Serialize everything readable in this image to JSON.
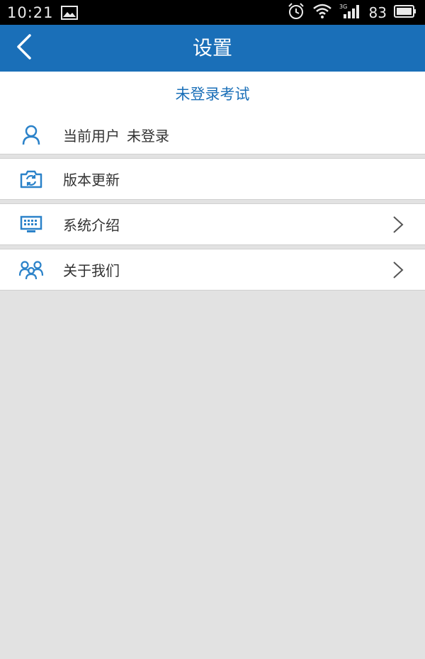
{
  "status_bar": {
    "time": "10:21",
    "battery": "83",
    "icons": [
      "image-icon",
      "alarm-icon",
      "wifi-icon",
      "3g-signal-icon",
      "battery-icon"
    ]
  },
  "header": {
    "title": "设置",
    "back_icon": "back-arrow-icon",
    "background": "#1a6fb8"
  },
  "login_banner": {
    "text": "未登录考试"
  },
  "user": {
    "label": "当前用户",
    "value": "未登录",
    "icon": "user-icon"
  },
  "menu": {
    "items": [
      {
        "label": "版本更新",
        "icon": "camera-refresh-icon",
        "has_chevron": false
      },
      {
        "label": "系统介绍",
        "icon": "keyboard-icon",
        "has_chevron": true
      },
      {
        "label": "关于我们",
        "icon": "group-icon",
        "has_chevron": true
      }
    ]
  },
  "colors": {
    "accent": "#1a6fb8",
    "icon": "#2b82c9",
    "background": "#e2e2e2"
  }
}
